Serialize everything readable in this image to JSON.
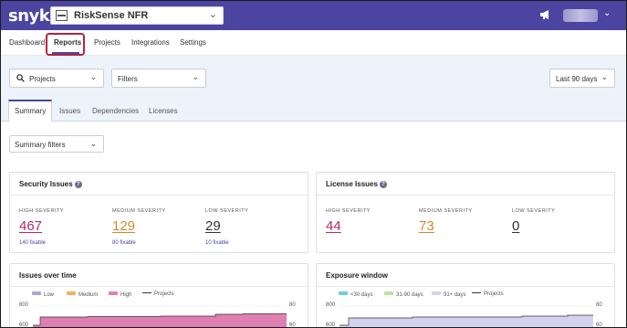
{
  "header": {
    "logo": "snyk",
    "org_name": "RiskSense NFR"
  },
  "nav": {
    "items": [
      "Dashboard",
      "Reports",
      "Projects",
      "Integrations",
      "Settings"
    ],
    "active": "Reports"
  },
  "filters": {
    "projects_label": "Projects",
    "filters_label": "Filters",
    "range_label": "Last 90 days"
  },
  "tabs": {
    "items": [
      "Summary",
      "Issues",
      "Dependencies",
      "Licenses"
    ],
    "active": "Summary"
  },
  "summary_filters_label": "Summary filters",
  "security_issues": {
    "title": "Security Issues",
    "high": {
      "label": "HIGH SEVERITY",
      "value": "467",
      "fixable": "140 fixable"
    },
    "medium": {
      "label": "MEDIUM SEVERITY",
      "value": "129",
      "fixable": "80 fixable"
    },
    "low": {
      "label": "LOW SEVERITY",
      "value": "29",
      "fixable": "10 fixable"
    }
  },
  "license_issues": {
    "title": "License Issues",
    "high": {
      "label": "HIGH SEVERITY",
      "value": "44"
    },
    "medium": {
      "label": "MEDIUM SEVERITY",
      "value": "73"
    },
    "low": {
      "label": "LOW SEVERITY",
      "value": "0"
    }
  },
  "issues_over_time": {
    "title": "Issues over time",
    "legend": [
      "Low",
      "Medium",
      "High",
      "Projects"
    ],
    "y_left_ticks": [
      "800",
      "600"
    ],
    "y_right_ticks": [
      "80",
      "60"
    ]
  },
  "exposure_window": {
    "title": "Exposure window",
    "legend": [
      "<30 days",
      "31-90 days",
      "91+ days",
      "Projects"
    ],
    "y_left_ticks": [
      "800",
      "600"
    ],
    "y_right_ticks": [
      "80",
      "60"
    ]
  },
  "colors": {
    "brand": "#4b45a1",
    "high": "#b02a6a",
    "medium": "#d08a2c",
    "low": "#9b97c9",
    "high_area": "#e07fb1",
    "medium_area": "#f2b25c",
    "low_area": "#a9a5d6",
    "lt30": "#6fcfd9",
    "d31_90": "#b8e3a3",
    "d91": "#d4d2ee"
  }
}
